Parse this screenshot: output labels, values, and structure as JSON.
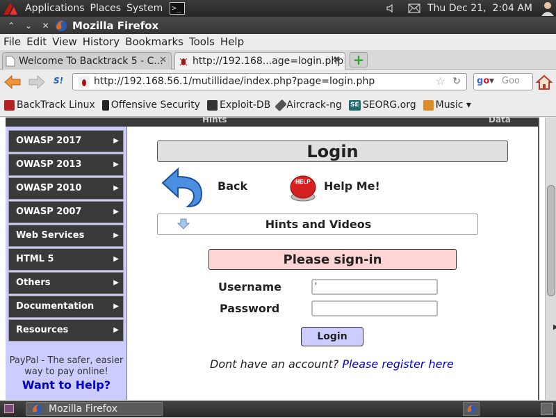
{
  "top_panel": {
    "menus": [
      "Applications",
      "Places",
      "System"
    ],
    "clock": "Thu Dec 21,  2:04 AM"
  },
  "window": {
    "title": "Mozilla Firefox"
  },
  "menubar": [
    "File",
    "Edit",
    "View",
    "History",
    "Bookmarks",
    "Tools",
    "Help"
  ],
  "tabs": [
    {
      "label": "Welcome To Backtrack 5 - C..."
    },
    {
      "label": "http://192.168...age=login.php"
    }
  ],
  "nav": {
    "url": "http://192.168.56.1/mutillidae/index.php?page=login.php",
    "search_placeholder": "Goo"
  },
  "bookmarks": [
    {
      "label": "BackTrack Linux",
      "color": "#b22222"
    },
    {
      "label": "Offensive Security",
      "color": "#222222"
    },
    {
      "label": "Exploit-DB",
      "color": "#333333"
    },
    {
      "label": "Aircrack-ng",
      "color": "#444444"
    },
    {
      "label": "SEORG.org",
      "color": "#1b6d6d"
    },
    {
      "label": "Music ▾",
      "color": "#d98c2a"
    }
  ],
  "page": {
    "top_strip_left": "Hints",
    "top_strip_right": "Data",
    "sidebar_menu": [
      "OWASP 2017",
      "OWASP 2013",
      "OWASP 2010",
      "OWASP 2007",
      "Web Services",
      "HTML 5",
      "Others",
      "Documentation",
      "Resources"
    ],
    "paypal_text": "PayPal - The safer, easier way to pay online!",
    "want_help": "Want to Help?",
    "login_title": "Login",
    "back_label": "Back",
    "help_label": "Help Me!",
    "help_button_text": "HELP",
    "hints_label": "Hints and Videos",
    "signin_title": "Please sign-in",
    "username_label": "Username",
    "username_value": "'",
    "password_label": "Password",
    "password_value": "",
    "login_button": "Login",
    "register_prompt": "Dont have an account?",
    "register_link": "Please register here"
  },
  "taskbar": {
    "task_label": "Mozilla Firefox"
  }
}
